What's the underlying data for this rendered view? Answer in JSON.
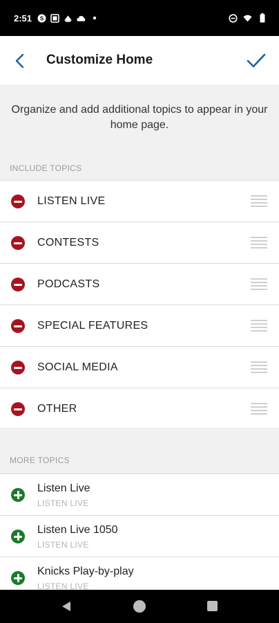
{
  "status_bar": {
    "time": "2:51",
    "icons_left": [
      "skype-icon",
      "gallery-icon",
      "cast-icon",
      "cloud-icon",
      "dot-icon"
    ],
    "icons_right": [
      "dnd-icon",
      "wifi-icon",
      "battery-icon"
    ]
  },
  "header": {
    "title": "Customize Home",
    "accent_color": "#1f5fa0"
  },
  "description": "Organize and add additional topics to appear in your home page.",
  "include_section": {
    "label": "INCLUDE TOPICS",
    "items": [
      {
        "label": "LISTEN LIVE"
      },
      {
        "label": "CONTESTS"
      },
      {
        "label": "PODCASTS"
      },
      {
        "label": "SPECIAL FEATURES"
      },
      {
        "label": "SOCIAL MEDIA"
      },
      {
        "label": "OTHER"
      }
    ],
    "remove_color": "#a8141e"
  },
  "more_section": {
    "label": "MORE TOPICS",
    "items": [
      {
        "title": "Listen Live",
        "subtitle": "LISTEN LIVE"
      },
      {
        "title": "Listen Live 1050",
        "subtitle": "LISTEN LIVE"
      },
      {
        "title": "Knicks Play-by-play",
        "subtitle": "LISTEN LIVE"
      }
    ],
    "add_color": "#1b7a2c"
  }
}
